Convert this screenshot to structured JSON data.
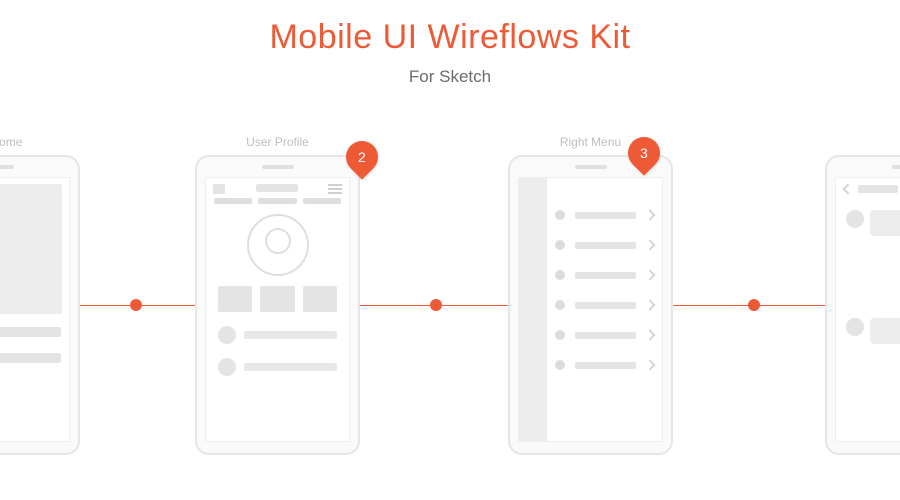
{
  "header": {
    "title": "Mobile UI Wireflows Kit",
    "subtitle": "For Sketch"
  },
  "colors": {
    "accent": "#ee5a36",
    "muted": "#e4e4e4"
  },
  "screens": [
    {
      "label": "Welcome"
    },
    {
      "label": "User Profile"
    },
    {
      "label": "Right Menu"
    },
    {
      "label": ""
    }
  ],
  "markers": [
    {
      "number": "2"
    },
    {
      "number": "3"
    }
  ]
}
